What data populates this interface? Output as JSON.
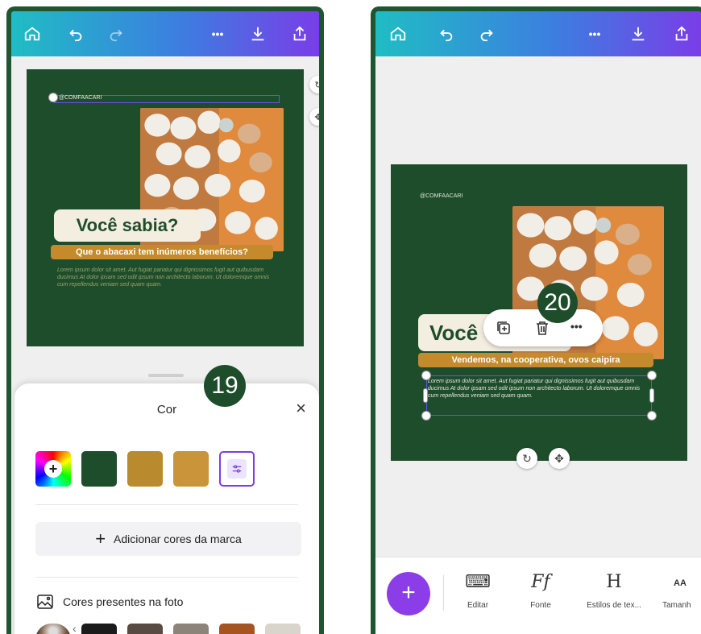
{
  "left": {
    "canvas": {
      "handle_text": "@COMFAACARI",
      "title": "Você sabia?",
      "subtitle": "Que o abacaxi tem inúmeros benefícios?",
      "lorem": "Lorem ipsum dolor sit amet. Aut fugiat pariatur qui dignissimos fugit aut quibusdam ducimus At dolor ipsam sed odit ipsum non architecto laborum. Ut doloremque omnis cum repellendus veniam sed quam quam."
    },
    "step_badge": "19",
    "color_panel": {
      "title": "Cor",
      "close": "×",
      "swatches": [
        {
          "name": "add-color",
          "color": "rainbow",
          "symbol": "+"
        },
        {
          "name": "dark-green",
          "color": "#1e4d2b"
        },
        {
          "name": "mustard",
          "color": "#b98a2e"
        },
        {
          "name": "gold",
          "color": "#c9943a"
        }
      ],
      "add_brand": "Adicionar cores da marca",
      "add_brand_plus": "+",
      "photo_colors_title": "Cores presentes na foto",
      "photo_colors": [
        "#1b1b1b",
        "#5a4a44",
        "#8c8479",
        "#a5541f",
        "#d9d4cc"
      ],
      "accent": "#7a3de8"
    }
  },
  "right": {
    "canvas": {
      "handle_text": "@COMFAACARI",
      "title": "Você",
      "subtitle": "Vendemos, na cooperativa, ovos caipira",
      "lorem": "Lorem ipsum dolor sit amet. Aut fugiat pariatur qui dignissimos fugit aut quibusdam ducimus At dolor ipsam sed odit ipsum non architecto laborum. Ut doloremque omnis cum repellendus veniam sed quam quam."
    },
    "step_badge": "20",
    "context_menu": {
      "more": "•••"
    },
    "toolbar": {
      "fab": "+",
      "items": [
        {
          "icon": "⌨",
          "label": "Editar"
        },
        {
          "icon": "Ff",
          "label": "Fonte"
        },
        {
          "icon": "H",
          "label": "Estilos de tex..."
        },
        {
          "icon": "AA",
          "label": "Tamanh"
        }
      ]
    }
  },
  "topbar": {
    "more": "•••"
  }
}
